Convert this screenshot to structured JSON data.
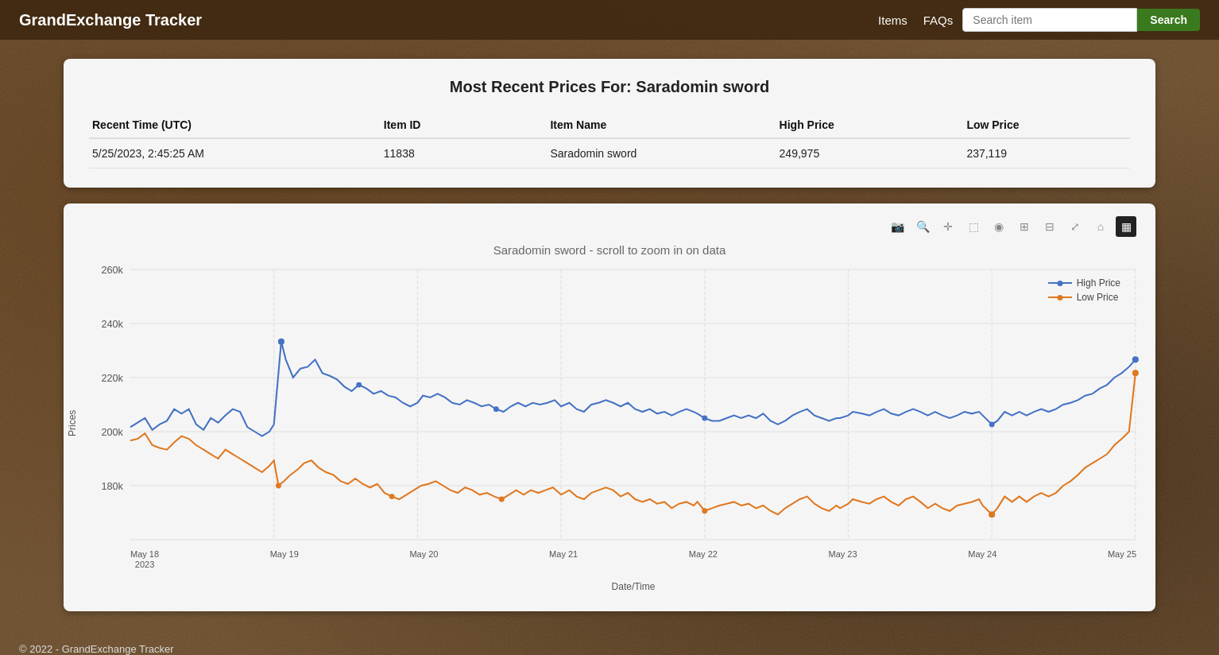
{
  "nav": {
    "brand": "GrandExchange Tracker",
    "links": [
      {
        "label": "Items",
        "id": "items"
      },
      {
        "label": "FAQs",
        "id": "faqs"
      }
    ],
    "search": {
      "placeholder": "Search item",
      "button_label": "Search"
    }
  },
  "price_card": {
    "title": "Most Recent Prices For: Saradomin sword",
    "table": {
      "headers": [
        "Recent Time (UTC)",
        "Item ID",
        "Item Name",
        "High Price",
        "Low Price"
      ],
      "rows": [
        [
          "5/25/2023, 2:45:25 AM",
          "11838",
          "Saradomin sword",
          "249,975",
          "237,119"
        ]
      ]
    }
  },
  "chart_card": {
    "title": "Saradomin sword - scroll to zoom in on data",
    "y_label": "Prices",
    "x_label": "Date/Time",
    "legend": [
      {
        "label": "High Price",
        "color": "#4472c4"
      },
      {
        "label": "Low Price",
        "color": "#e07820"
      }
    ],
    "y_axis": {
      "min": 170000,
      "max": 270000,
      "ticks": [
        "260k",
        "240k",
        "220k",
        "200k",
        "180k"
      ]
    },
    "x_axis": {
      "labels": [
        "May 18\n2023",
        "May 19",
        "May 20",
        "May 21",
        "May 22",
        "May 23",
        "May 24",
        "May 25"
      ]
    }
  },
  "footer": {
    "text": "© 2022 - GrandExchange Tracker"
  }
}
